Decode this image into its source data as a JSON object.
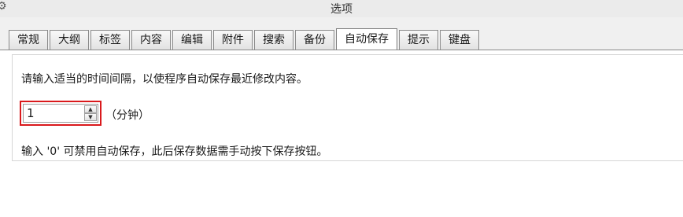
{
  "window": {
    "title": "选项",
    "icon": "gear-icon"
  },
  "tabs": [
    {
      "label": "常规"
    },
    {
      "label": "大纲"
    },
    {
      "label": "标签"
    },
    {
      "label": "内容"
    },
    {
      "label": "编辑"
    },
    {
      "label": "附件"
    },
    {
      "label": "搜索"
    },
    {
      "label": "备份"
    },
    {
      "label": "自动保存",
      "active": true
    },
    {
      "label": "提示"
    },
    {
      "label": "键盘"
    }
  ],
  "autosave": {
    "description": "请输入适当的时间间隔，以使程序自动保存最近修改内容。",
    "interval_value": "1",
    "unit_label": "（分钟）",
    "note": "输入 '0' 可禁用自动保存，此后保存数据需手动按下保存按钮。",
    "highlight_color": "#d9191c"
  }
}
